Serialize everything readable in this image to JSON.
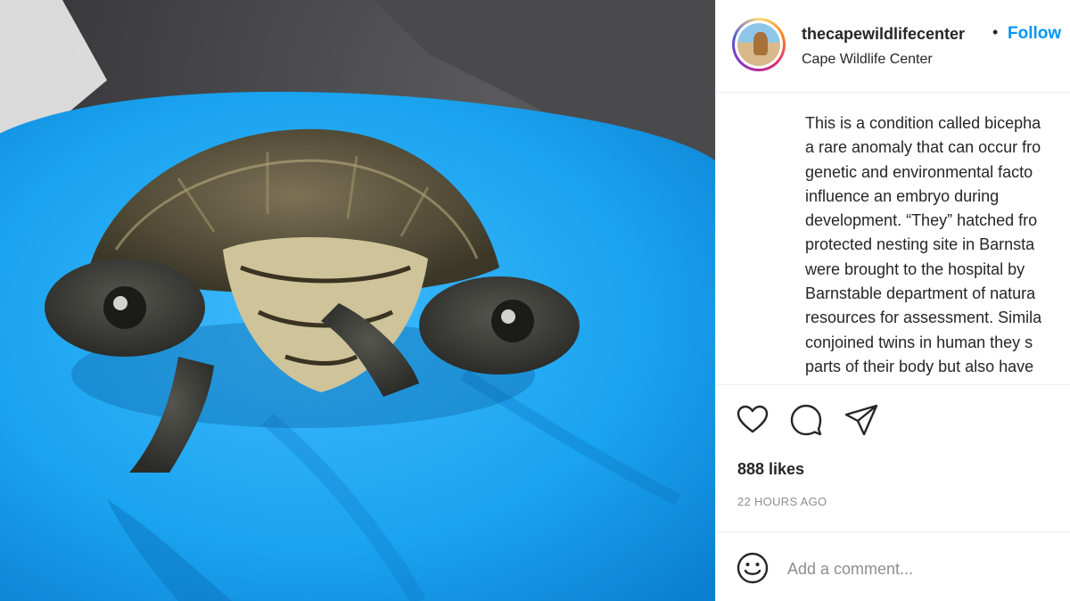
{
  "post": {
    "username": "thecapewildlifecenter",
    "separator": "•",
    "follow_label": "Follow",
    "location": "Cape Wildlife Center",
    "caption_lines": [
      "This is a condition called bicepha",
      "a rare anomaly that can occur fro",
      "genetic and environmental facto",
      "influence an embryo during",
      "development. “They” hatched fro",
      "protected nesting site in Barnsta",
      "were brought to the hospital by",
      "Barnstable department of natura",
      "resources for assessment. Simila",
      "conjoined twins in human they s",
      "parts of their body but also have"
    ],
    "likes": "888 likes",
    "timestamp": "22 HOURS AGO",
    "comment_placeholder": "Add a comment..."
  },
  "icons": {
    "like": "heart-icon",
    "comment": "speech-bubble-icon",
    "share": "paper-plane-icon",
    "emoji": "smiley-icon"
  },
  "colors": {
    "link_blue": "#0095f6",
    "text": "#262626",
    "muted": "#8e8e8e",
    "glove_blue": "#1aa3ef"
  }
}
